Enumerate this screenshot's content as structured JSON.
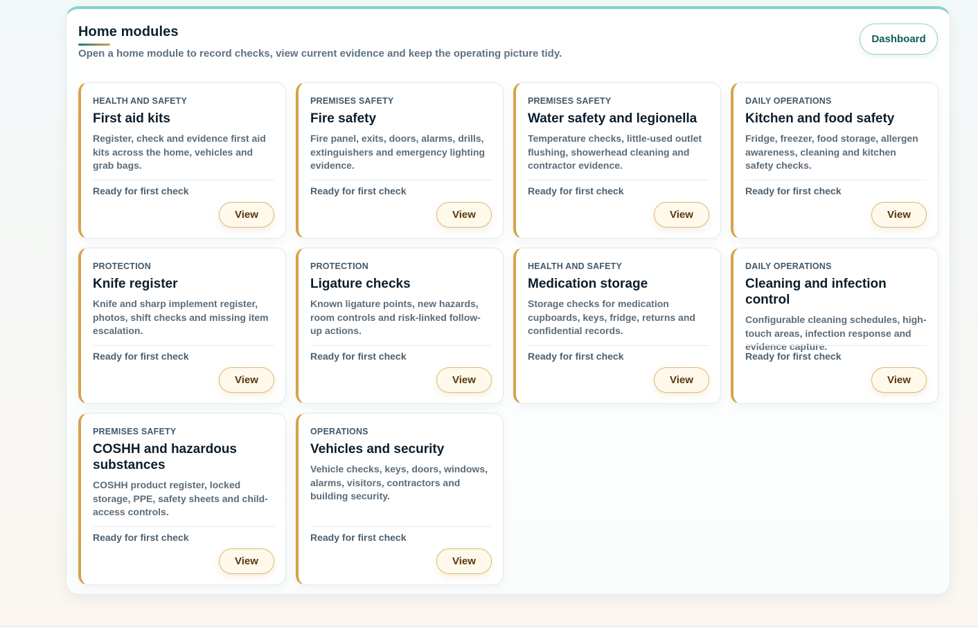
{
  "header": {
    "title": "Home modules",
    "subtitle": "Open a home module to record checks, view current evidence and keep the operating picture tidy.",
    "dashboard_label": "Dashboard"
  },
  "accent_colors": {
    "teal": "#7fd4cc",
    "gold": "#d8a24c"
  },
  "modules": [
    {
      "category": "Health and safety",
      "title": "First aid kits",
      "description": "Register, check and evidence first aid kits across the home, vehicles and grab bags.",
      "status": "Ready for first check",
      "action": "View"
    },
    {
      "category": "Premises safety",
      "title": "Fire safety",
      "description": "Fire panel, exits, doors, alarms, drills, extinguishers and emergency lighting evidence.",
      "status": "Ready for first check",
      "action": "View"
    },
    {
      "category": "Premises safety",
      "title": "Water safety and legionella",
      "description": "Temperature checks, little-used outlet flushing, showerhead cleaning and contractor evidence.",
      "status": "Ready for first check",
      "action": "View"
    },
    {
      "category": "Daily operations",
      "title": "Kitchen and food safety",
      "description": "Fridge, freezer, food storage, allergen awareness, cleaning and kitchen safety checks.",
      "status": "Ready for first check",
      "action": "View"
    },
    {
      "category": "Protection",
      "title": "Knife register",
      "description": "Knife and sharp implement register, photos, shift checks and missing item escalation.",
      "status": "Ready for first check",
      "action": "View"
    },
    {
      "category": "Protection",
      "title": "Ligature checks",
      "description": "Known ligature points, new hazards, room controls and risk-linked follow-up actions.",
      "status": "Ready for first check",
      "action": "View"
    },
    {
      "category": "Health and safety",
      "title": "Medication storage",
      "description": "Storage checks for medication cupboards, keys, fridge, returns and confidential records.",
      "status": "Ready for first check",
      "action": "View"
    },
    {
      "category": "Daily operations",
      "title": "Cleaning and infection control",
      "description": "Configurable cleaning schedules, high-touch areas, infection response and evidence capture.",
      "status": "Ready for first check",
      "action": "View"
    },
    {
      "category": "Premises safety",
      "title": "COSHH and hazardous substances",
      "description": "COSHH product register, locked storage, PPE, safety sheets and child-access controls.",
      "status": "Ready for first check",
      "action": "View"
    },
    {
      "category": "Operations",
      "title": "Vehicles and security",
      "description": "Vehicle checks, keys, doors, windows, alarms, visitors, contractors and building security.",
      "status": "Ready for first check",
      "action": "View"
    }
  ]
}
